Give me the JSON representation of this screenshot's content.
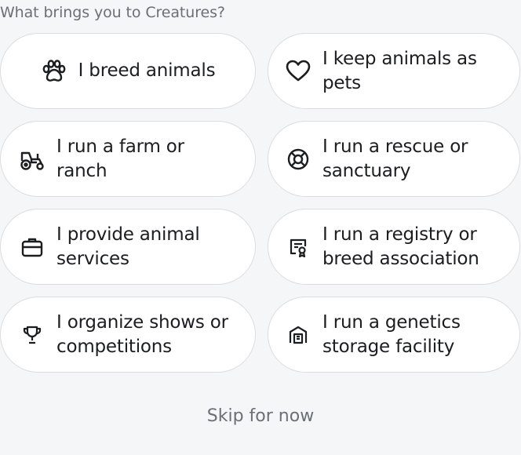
{
  "prompt": "What brings you to Creatures?",
  "options": [
    {
      "label": "I breed animals",
      "icon": "paw-icon"
    },
    {
      "label": "I keep animals as pets",
      "icon": "heart-icon"
    },
    {
      "label": "I run a farm or ranch",
      "icon": "tractor-icon"
    },
    {
      "label": "I run a rescue or sanctuary",
      "icon": "lifebuoy-icon"
    },
    {
      "label": "I provide animal services",
      "icon": "briefcase-icon"
    },
    {
      "label": "I run a registry or breed association",
      "icon": "certificate-icon"
    },
    {
      "label": "I organize shows or competitions",
      "icon": "trophy-icon"
    },
    {
      "label": "I run a genetics storage facility",
      "icon": "storage-facility-icon"
    }
  ],
  "skip_label": "Skip for now"
}
